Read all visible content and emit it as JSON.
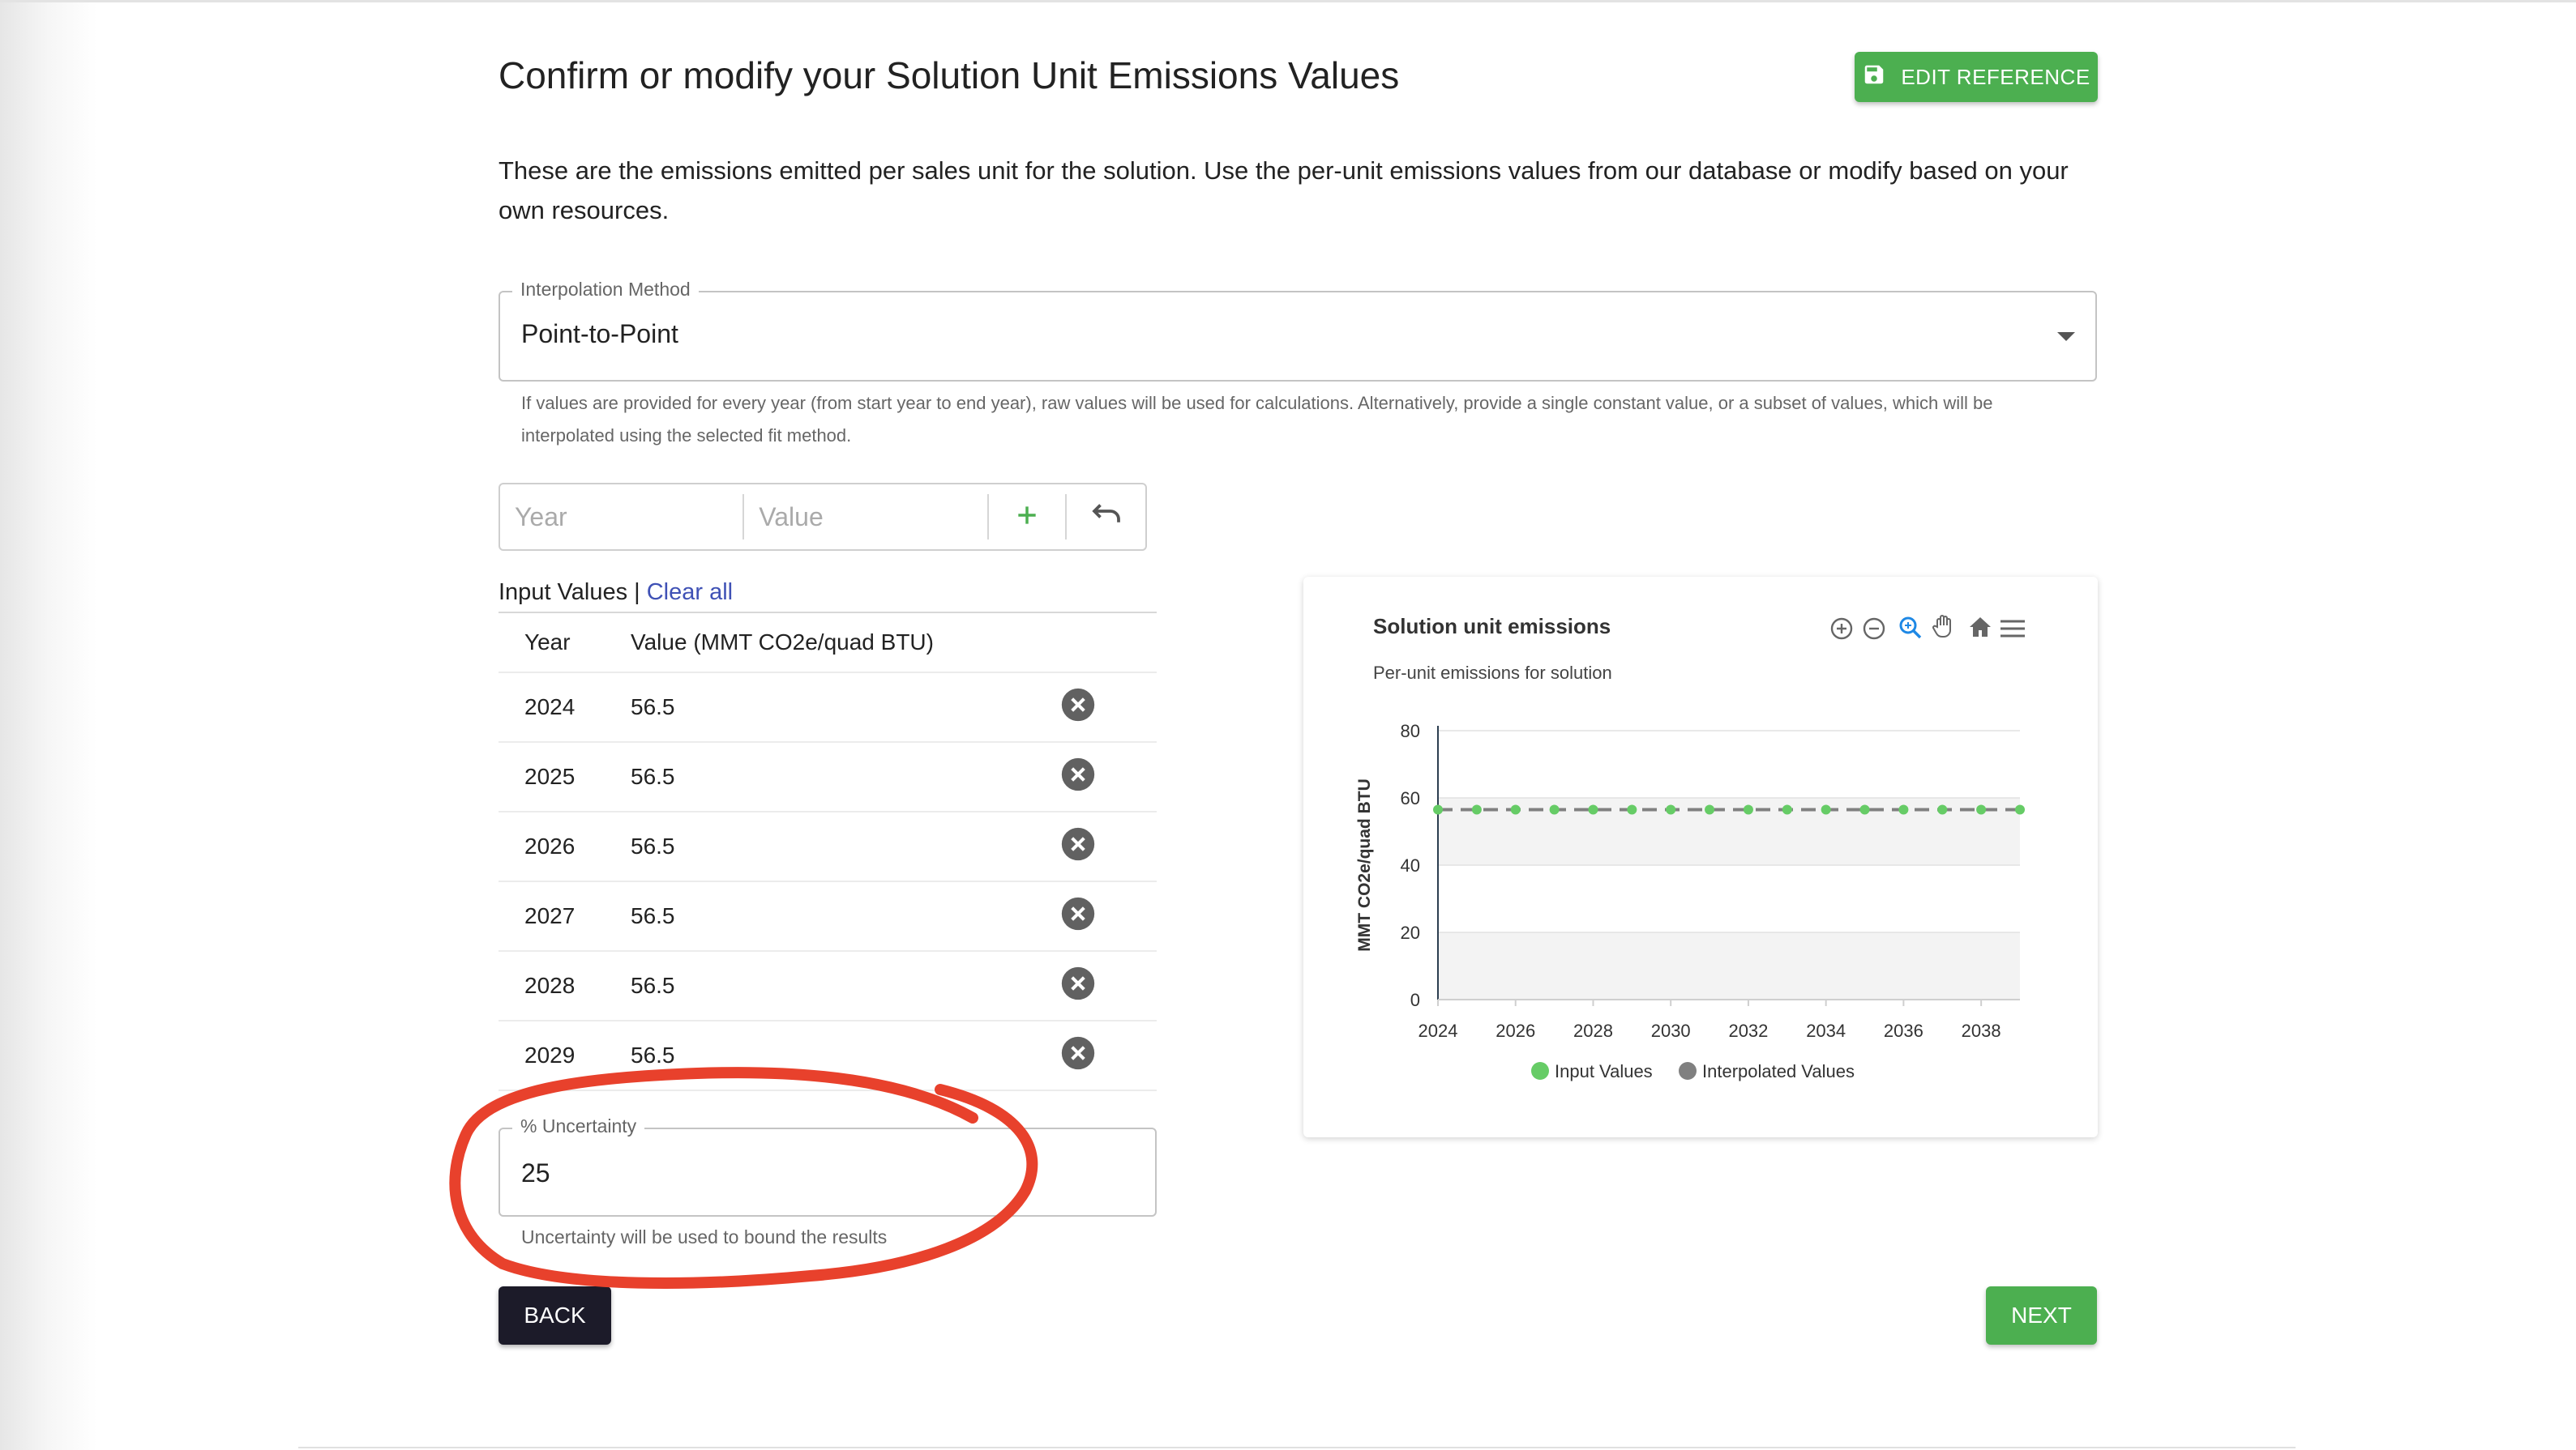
{
  "header": {
    "title": "Confirm or modify your Solution Unit Emissions Values",
    "edit_reference_label": "EDIT REFERENCE"
  },
  "description": "These are the emissions emitted per sales unit for the solution. Use the per-unit emissions values from our database or modify based on your own resources.",
  "interpolation": {
    "label": "Interpolation Method",
    "value": "Point-to-Point",
    "helper": "If values are provided for every year (from start year to end year), raw values will be used for calculations. Alternatively, provide a single constant value, or a subset of values, which will be interpolated using the selected fit method."
  },
  "add_value": {
    "year_placeholder": "Year",
    "value_placeholder": "Value",
    "add_icon": "plus-icon",
    "undo_icon": "undo-icon"
  },
  "input_values": {
    "title": "Input Values",
    "separator": " | ",
    "clear_all": "Clear all",
    "columns": [
      "Year",
      "Value (MMT CO2e/quad BTU)"
    ],
    "rows": [
      {
        "year": "2024",
        "value": "56.5"
      },
      {
        "year": "2025",
        "value": "56.5"
      },
      {
        "year": "2026",
        "value": "56.5"
      },
      {
        "year": "2027",
        "value": "56.5"
      },
      {
        "year": "2028",
        "value": "56.5"
      },
      {
        "year": "2029",
        "value": "56.5"
      }
    ]
  },
  "uncertainty": {
    "label": "% Uncertainty",
    "value": "25",
    "helper": "Uncertainty will be used to bound the results"
  },
  "nav": {
    "back_label": "BACK",
    "next_label": "NEXT"
  },
  "colors": {
    "accent_green": "#4caf50",
    "dark_button": "#1c1b29",
    "link_blue": "#3f51b5",
    "annotation_red": "#e8412c",
    "point_green": "#66cc66",
    "line_gray": "#808080"
  },
  "chart_data": {
    "type": "line",
    "title": "Solution unit emissions",
    "subtitle": "Per-unit emissions for solution",
    "ylabel": "MMT CO2e/quad BTU",
    "xlabel": "",
    "ylim": [
      0,
      80
    ],
    "xlim": [
      2024,
      2039
    ],
    "yticks": [
      0,
      20,
      40,
      60,
      80
    ],
    "xticks": [
      2024,
      2026,
      2028,
      2030,
      2032,
      2034,
      2036,
      2038
    ],
    "series": [
      {
        "name": "Input Values",
        "color": "#66cc66",
        "x": [
          2024,
          2025,
          2026,
          2027,
          2028,
          2029,
          2030,
          2031,
          2032,
          2033,
          2034,
          2035,
          2036,
          2037,
          2038,
          2039
        ],
        "y": [
          56.5,
          56.5,
          56.5,
          56.5,
          56.5,
          56.5,
          56.5,
          56.5,
          56.5,
          56.5,
          56.5,
          56.5,
          56.5,
          56.5,
          56.5,
          56.5
        ]
      },
      {
        "name": "Interpolated Values",
        "color": "#808080",
        "x": [
          2024,
          2039
        ],
        "y": [
          56.5,
          56.5
        ]
      }
    ],
    "legend": [
      "Input Values",
      "Interpolated Values"
    ],
    "legend_colors": [
      "#66cc66",
      "#808080"
    ],
    "legend_position": "bottom",
    "grid": true,
    "toolbar_icons": [
      "zoom-in-icon",
      "zoom-out-icon",
      "selection-zoom-icon",
      "pan-icon",
      "reset-home-icon",
      "menu-icon"
    ]
  }
}
